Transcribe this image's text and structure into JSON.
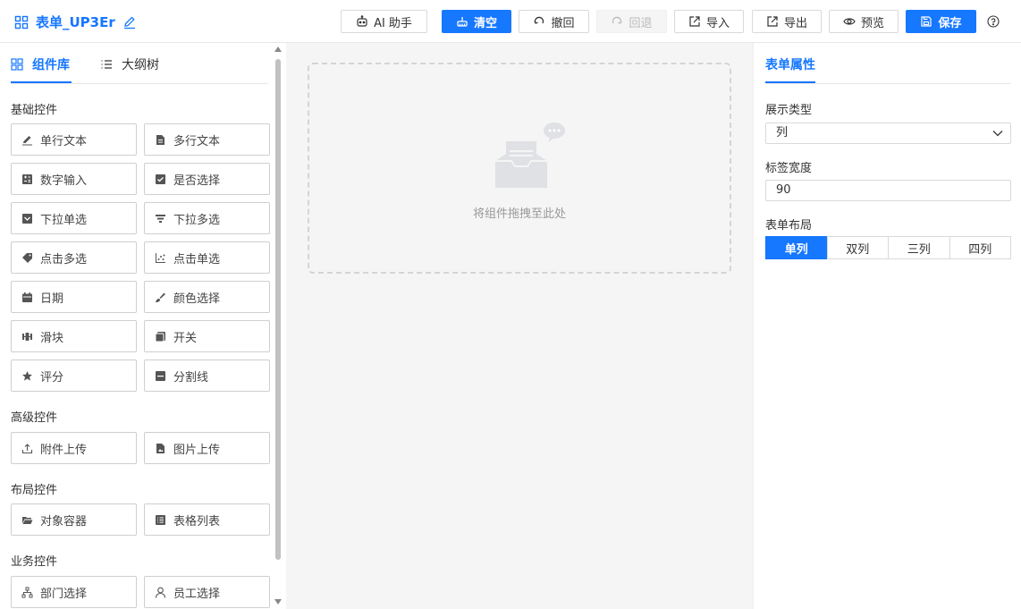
{
  "header": {
    "title": "表单_UP3Er",
    "buttons": {
      "ai": "AI 助手",
      "clear": "清空",
      "undo": "撤回",
      "redo": "回退",
      "import": "导入",
      "export": "导出",
      "preview": "预览",
      "save": "保存"
    }
  },
  "left": {
    "tabs": {
      "library": "组件库",
      "outline": "大纲树"
    },
    "sections": {
      "basic": "基础控件",
      "advanced": "高级控件",
      "layout": "布局控件",
      "business": "业务控件"
    },
    "basic": [
      "单行文本",
      "多行文本",
      "数字输入",
      "是否选择",
      "下拉单选",
      "下拉多选",
      "点击多选",
      "点击单选",
      "日期",
      "颜色选择",
      "滑块",
      "开关",
      "评分",
      "分割线"
    ],
    "advanced": [
      "附件上传",
      "图片上传"
    ],
    "layout": [
      "对象容器",
      "表格列表"
    ],
    "business": [
      "部门选择",
      "员工选择"
    ]
  },
  "canvas": {
    "placeholder": "将组件拖拽至此处"
  },
  "right": {
    "tab": "表单属性",
    "display_type_label": "展示类型",
    "display_type_value": "列",
    "label_width_label": "标签宽度",
    "label_width_value": "90",
    "layout_label": "表单布局",
    "layout_options": [
      "单列",
      "双列",
      "三列",
      "四列"
    ],
    "layout_selected": "单列"
  },
  "colors": {
    "accent": "#1677ff",
    "canvas_bg": "#f5f5f5",
    "border": "#d9d9d9"
  }
}
